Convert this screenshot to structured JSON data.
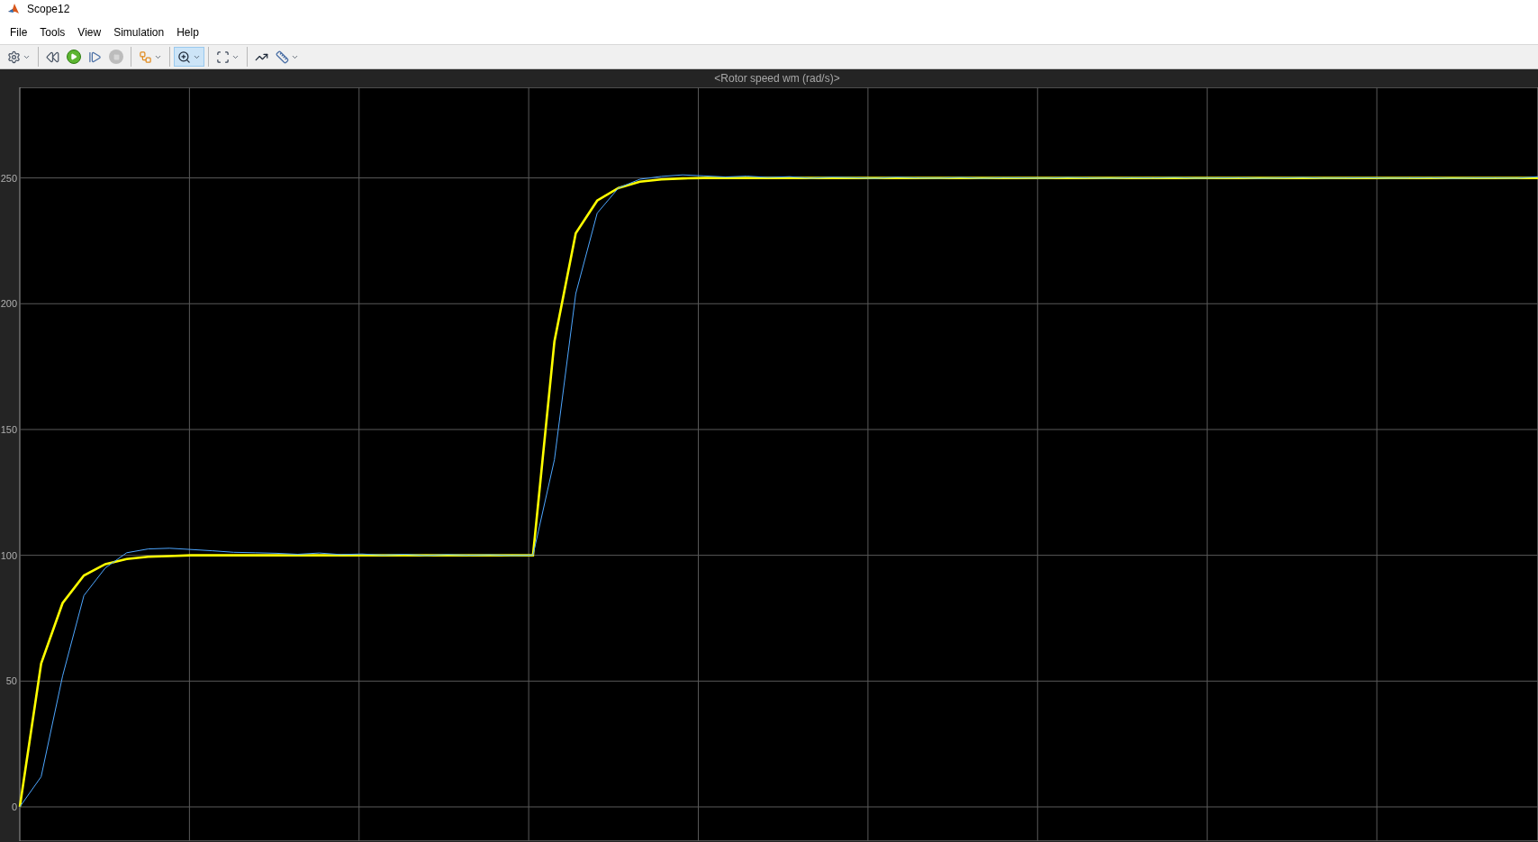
{
  "window": {
    "title": "Scope12"
  },
  "menu": [
    "File",
    "Tools",
    "View",
    "Simulation",
    "Help"
  ],
  "toolbar": [
    {
      "kind": "settings",
      "dropdown": true,
      "selected": false,
      "disabled": false
    },
    {
      "kind": "separator"
    },
    {
      "kind": "step-back",
      "dropdown": false,
      "selected": false,
      "disabled": false
    },
    {
      "kind": "run",
      "dropdown": false,
      "selected": false,
      "disabled": false
    },
    {
      "kind": "step-forward",
      "dropdown": false,
      "selected": false,
      "disabled": false
    },
    {
      "kind": "stop",
      "dropdown": false,
      "selected": false,
      "disabled": true
    },
    {
      "kind": "separator"
    },
    {
      "kind": "highlight",
      "dropdown": true,
      "selected": false,
      "disabled": false
    },
    {
      "kind": "separator"
    },
    {
      "kind": "zoom",
      "dropdown": true,
      "selected": true,
      "disabled": false
    },
    {
      "kind": "separator"
    },
    {
      "kind": "fit",
      "dropdown": true,
      "selected": false,
      "disabled": false
    },
    {
      "kind": "separator"
    },
    {
      "kind": "triggers",
      "dropdown": false,
      "selected": false,
      "disabled": false
    },
    {
      "kind": "measure",
      "dropdown": true,
      "selected": false,
      "disabled": false
    }
  ],
  "plot": {
    "title": "<Rotor speed wm (rad/s)>",
    "chart_data": {
      "type": "line",
      "grid": true,
      "ylim": [
        -13.6,
        286
      ],
      "yticks": [
        0,
        50,
        100,
        150,
        200,
        250
      ],
      "series": [
        {
          "color": "#ffff00",
          "values": [
            0,
            57,
            81,
            92,
            96.5,
            98.5,
            99.4,
            99.7,
            100,
            100,
            100,
            100,
            100,
            100,
            100,
            100,
            100,
            100,
            100,
            100,
            100,
            100,
            100,
            100,
            100,
            185,
            228,
            241,
            246,
            248.5,
            249.4,
            249.8,
            250,
            250,
            250,
            250,
            250,
            250,
            250,
            250,
            250,
            250,
            250,
            250,
            250,
            250,
            250,
            250,
            250,
            250,
            250,
            250,
            250,
            250,
            250,
            250,
            250,
            250,
            250,
            250,
            250,
            250,
            250,
            250,
            250,
            250,
            250,
            250,
            250,
            250,
            250,
            250
          ]
        },
        {
          "color": "#4da6ff",
          "values": [
            0,
            12,
            52,
            84,
            95,
            101,
            102.5,
            102.8,
            102.3,
            101.8,
            101.2,
            101,
            100.8,
            100.4,
            100.9,
            100.3,
            100.5,
            100.1,
            100.4,
            99.9,
            100.3,
            100,
            100.2,
            99.9,
            100,
            138,
            204,
            236,
            246,
            249.5,
            250.6,
            251.2,
            250.8,
            250.4,
            250.7,
            250.2,
            250.5,
            249.9,
            250.3,
            250.1,
            249.8,
            250.3,
            250,
            249.9,
            250.2,
            249.8,
            250.1,
            250,
            249.9,
            250.2,
            250,
            249.8,
            250.1,
            250,
            250.2,
            249.9,
            250,
            250.1,
            249.8,
            250,
            250.2,
            249.9,
            250,
            250.1,
            249.9,
            250,
            250.1,
            249.8,
            250,
            250,
            249.9,
            250.5
          ]
        }
      ]
    }
  }
}
